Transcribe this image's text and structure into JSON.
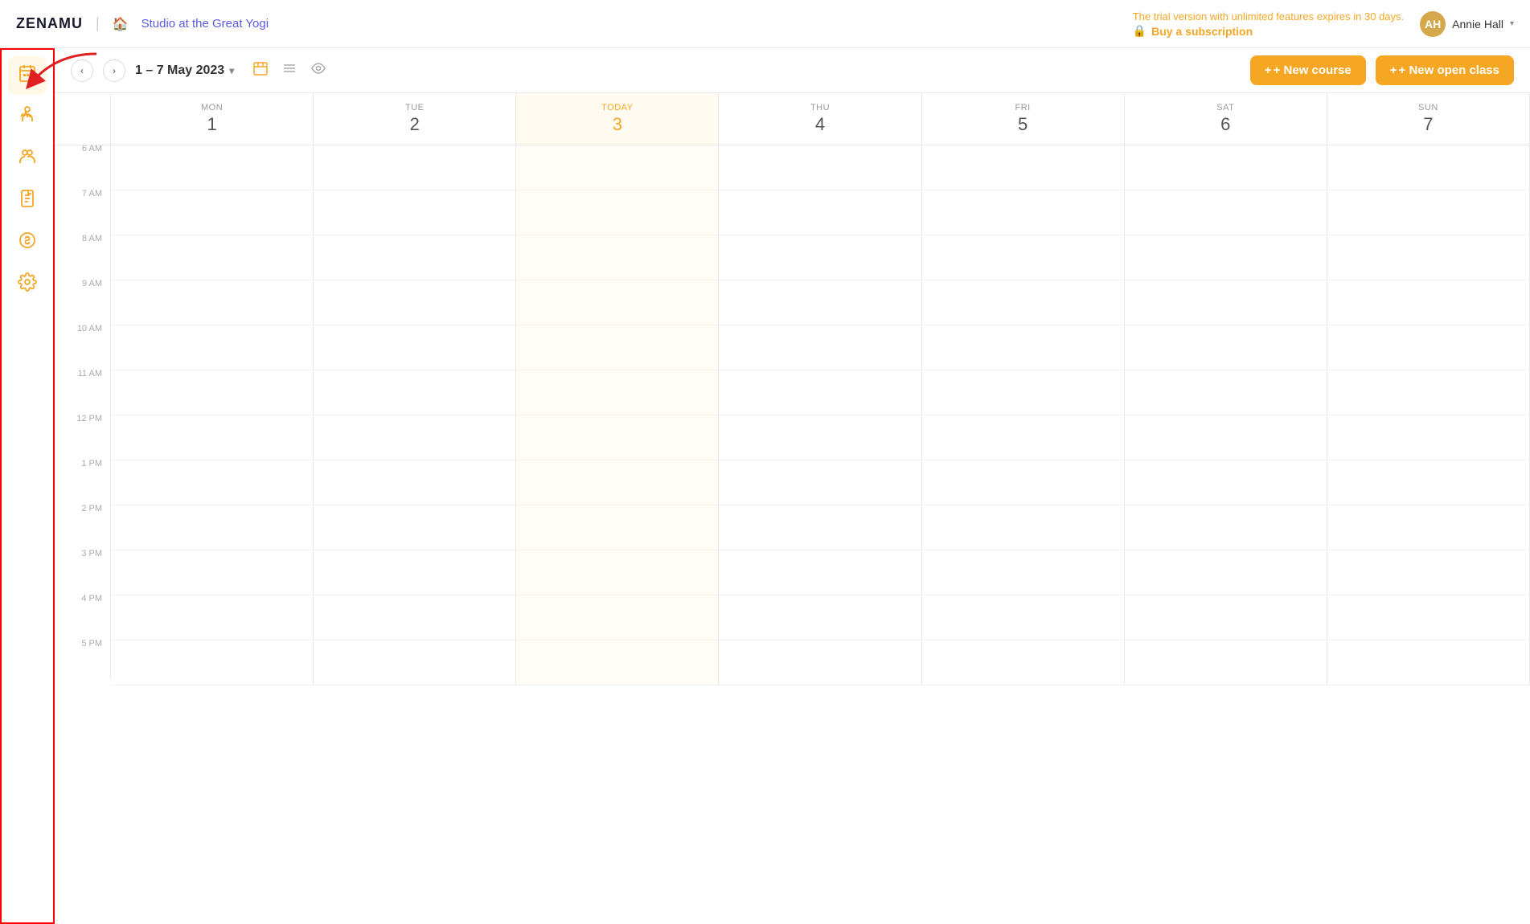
{
  "app": {
    "logo": "ZENAMU",
    "studio_name": "Studio at the Great Yogi"
  },
  "trial_banner": {
    "line1": "The trial version with unlimited features expires in 30 days.",
    "buy_label": "Buy a subscription"
  },
  "user": {
    "name": "Annie Hall",
    "initials": "AH"
  },
  "toolbar": {
    "date_range": "1 – 7 May 2023",
    "new_course_label": "+ New course",
    "new_open_class_label": "+ New open class"
  },
  "calendar": {
    "days": [
      {
        "name": "MON",
        "num": "1",
        "today": false
      },
      {
        "name": "TUE",
        "num": "2",
        "today": false
      },
      {
        "name": "TODAY",
        "num": "3",
        "today": true
      },
      {
        "name": "THU",
        "num": "4",
        "today": false
      },
      {
        "name": "FRI",
        "num": "5",
        "today": false
      },
      {
        "name": "SAT",
        "num": "6",
        "today": false
      },
      {
        "name": "SUN",
        "num": "7",
        "today": false
      }
    ],
    "time_slots": [
      "6 AM",
      "7 AM",
      "8 AM",
      "9 AM",
      "10 AM",
      "11 AM",
      "12 PM",
      "1 PM",
      "2 PM",
      "3 PM",
      "4 PM",
      "5 PM"
    ]
  },
  "sidebar": {
    "items": [
      {
        "id": "calendar",
        "icon": "📅",
        "label": "Calendar",
        "active": true
      },
      {
        "id": "classes",
        "icon": "🧘",
        "label": "Classes"
      },
      {
        "id": "members",
        "icon": "👥",
        "label": "Members"
      },
      {
        "id": "reports",
        "icon": "📋",
        "label": "Reports"
      },
      {
        "id": "billing",
        "icon": "💰",
        "label": "Billing"
      },
      {
        "id": "settings",
        "icon": "⚙️",
        "label": "Settings"
      }
    ]
  }
}
